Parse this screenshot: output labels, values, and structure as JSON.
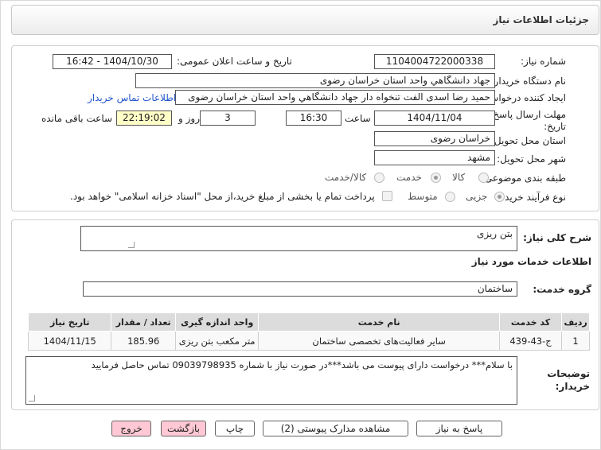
{
  "header": {
    "title": "جزئیات اطلاعات نیاز"
  },
  "fields": {
    "need_number_label": "شماره نیاز:",
    "need_number": "1104004722000338",
    "announce_label": "تاریخ و ساعت اعلان عمومی:",
    "announce_value": "1404/10/30 - 16:42",
    "buyer_org_label": "نام دستگاه خریدار:",
    "buyer_org": "جهاد دانشگاهي واحد استان خراسان رضوی",
    "creator_label": "ایجاد کننده درخواست:",
    "creator": "حمید رضا اسدی الفت تنخواه دار جهاد دانشگاهي واحد استان خراسان رضوی",
    "contact_link": "اطلاعات تماس خریدار",
    "deadline_label_1": "مهلت ارسال پاسخ: تا",
    "deadline_label_2": "تاریخ:",
    "deadline_date": "1404/11/04",
    "time_label": "ساعت",
    "deadline_time": "16:30",
    "days_value": "3",
    "days_label": "روز و",
    "remaining_time": "22:19:02",
    "remaining_label": "ساعت باقی مانده",
    "province_label": "استان محل تحویل:",
    "province": "خراسان رضوی",
    "city_label": "شهر محل تحویل:",
    "city": "مشهد",
    "category_label": "طبقه بندی موضوعی:",
    "category_options": [
      "کالا",
      "خدمت",
      "کالا/خدمت"
    ],
    "process_label": "نوع فرآیند خرید :",
    "process_options": [
      "جزیی",
      "متوسط"
    ],
    "payment_text": "پرداخت تمام یا بخشی از مبلغ خرید،از محل \"اسناد خزانه اسلامی\" خواهد بود."
  },
  "summary": {
    "label": "شرح کلی نیاز:",
    "value": "بتن ریزی"
  },
  "services": {
    "section_title": "اطلاعات خدمات مورد نیاز",
    "group_label": "گروه خدمت:",
    "group_value": "ساختمان",
    "columns": [
      "ردیف",
      "کد خدمت",
      "نام خدمت",
      "واحد اندازه گیری",
      "تعداد / مقدار",
      "تاریخ نیاز"
    ],
    "rows": [
      [
        "1",
        "ج-43-439",
        "سایر فعالیت‌های تخصصی ساختمان",
        "متر مکعب بتن ریزی",
        "185.96",
        "1404/11/15"
      ]
    ]
  },
  "buyer_notes": {
    "label_1": "توضیحات",
    "label_2": "خریدار:",
    "value": "با سلام*** درخواست دارای پیوست می باشد***در صورت نیاز با شماره 09039798935 تماس حاصل فرمایید"
  },
  "buttons": {
    "reply": "پاسخ به نیاز",
    "attachments": "مشاهده مدارک پیوستی (2)",
    "print": "چاپ",
    "back": "بازگشت",
    "exit": "خروج"
  },
  "watermark": {
    "text": "AriaTender.net"
  },
  "colors": {
    "link": "#2255cc",
    "remaining_bg": "#ffffc8",
    "button_pink": "#ffc8d4",
    "watermark": "#e8d8d8"
  }
}
